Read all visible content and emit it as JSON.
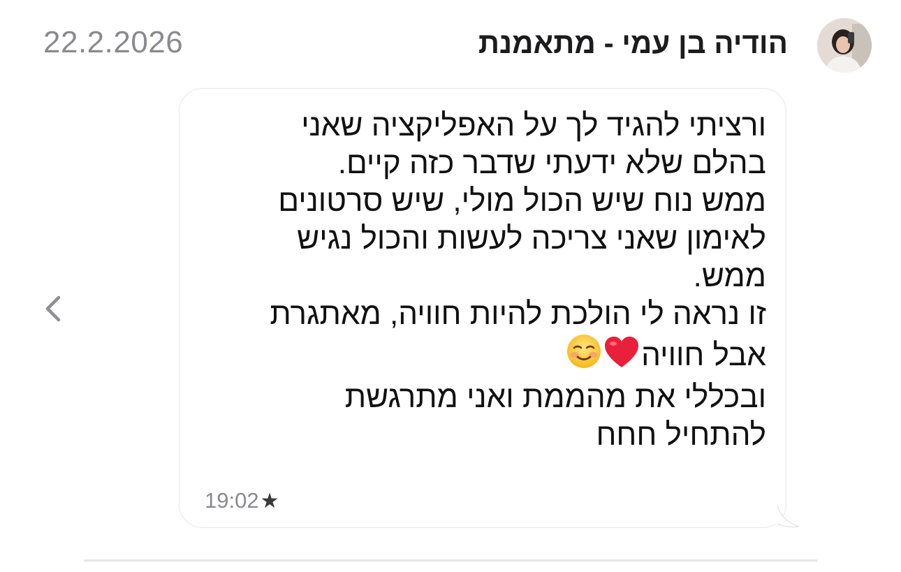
{
  "header": {
    "date": "22.2.2026",
    "sender_name": "הודיה בן עמי - מתאמנת"
  },
  "message": {
    "lines": [
      "ורציתי להגיד לך על האפליקציה שאני",
      "בהלם שלא ידעתי שדבר כזה קיים.",
      "ממש נוח שיש הכול מולי, שיש סרטונים",
      "לאימון שאני צריכה לעשות והכול נגיש",
      "ממש.",
      "זו נראה לי הולכת להיות חוויה, מאתגרת",
      "אבל חוויה",
      "ובכללי את מהממת ואני מתרגשת",
      "להתחיל חחח"
    ],
    "emojis": [
      "red-heart-icon",
      "smiling-face-icon"
    ],
    "time": "19:02",
    "starred": true
  },
  "icons": {
    "back": "chevron-left-icon",
    "star": "star-icon"
  }
}
